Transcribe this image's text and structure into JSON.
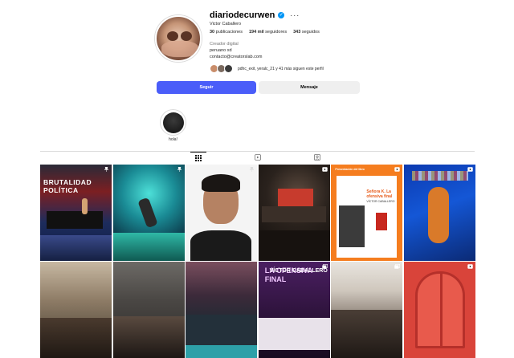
{
  "profile": {
    "username": "diariodecurwen",
    "full_name": "Victor Caballero",
    "more_icon": "ellipsis-icon",
    "verified_icon": "verified-badge-icon",
    "stats": {
      "posts_count": "30",
      "posts_label": "publicaciones",
      "followers_count": "194 mil",
      "followers_label": "seguidores",
      "following_count": "343",
      "following_label": "seguidos"
    },
    "category": "Creador digital",
    "bio_line1": "peruano xd",
    "bio_line2": "contacto@creatorslab.com",
    "followed_by": "pdhc_exit, yeralc_21 y 41 más siguen este perfil"
  },
  "actions": {
    "follow_label": "Seguir",
    "message_label": "Mensaje",
    "accent_color": "#4a5df9"
  },
  "highlights": [
    {
      "label": "hola!"
    }
  ],
  "tabs": [
    {
      "name": "posts",
      "icon": "grid-icon",
      "active": true
    },
    {
      "name": "reels",
      "icon": "reels-icon",
      "active": false
    },
    {
      "name": "tagged",
      "icon": "tagged-icon",
      "active": false
    }
  ],
  "posts": {
    "p1_title": "BRUTALIDAD POLÍTICA",
    "p5_top": "Presentación del libro",
    "p5_title": "Señora K. La ofensiva final",
    "p5_author": "VÍCTOR CABALLERO",
    "p10_title": "LA OFENSIVA FINAL",
    "p10_name": "VÍCTOR CABALLERO"
  }
}
